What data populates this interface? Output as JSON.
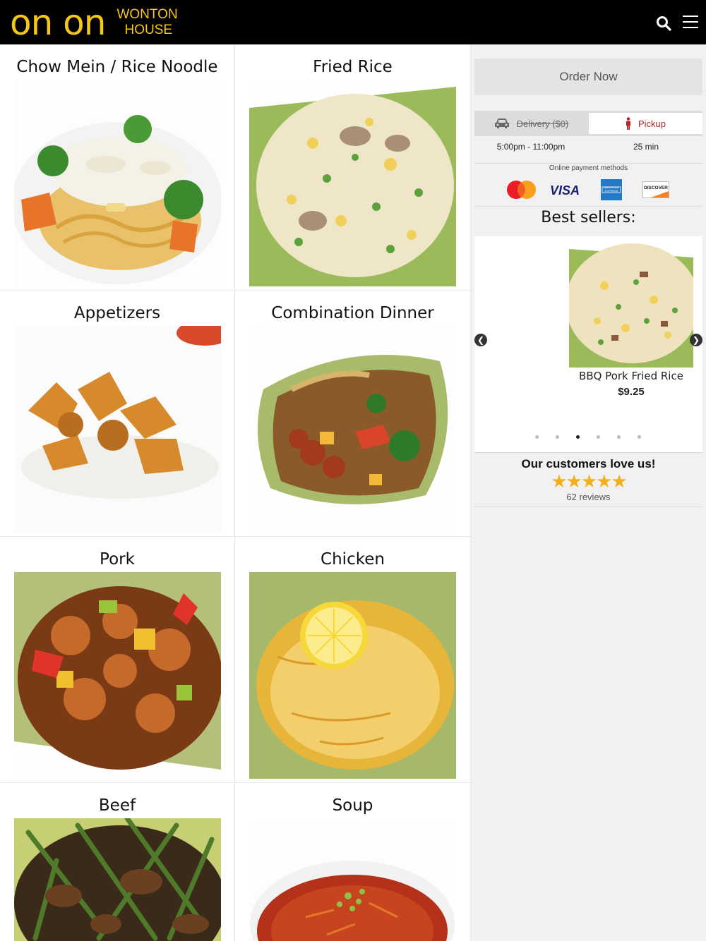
{
  "header": {
    "logo_mark": "on on",
    "logo_line1": "WONTON",
    "logo_line2": "HOUSE",
    "search_icon": "search-icon",
    "menu_icon": "hamburger-menu-icon",
    "brand_color": "#f5c518"
  },
  "categories": [
    {
      "title": "Chow Mein / Rice Noodle",
      "image": "chow-mein-photo"
    },
    {
      "title": "Fried Rice",
      "image": "fried-rice-photo"
    },
    {
      "title": "Appetizers",
      "image": "appetizers-photo"
    },
    {
      "title": "Combination Dinner",
      "image": "combination-dinner-photo"
    },
    {
      "title": "Pork",
      "image": "pork-photo"
    },
    {
      "title": "Chicken",
      "image": "chicken-photo"
    },
    {
      "title": "Beef",
      "image": "beef-photo"
    },
    {
      "title": "Soup",
      "image": "soup-photo"
    }
  ],
  "sidebar": {
    "order_now": "Order Now",
    "delivery_label": "Delivery ($0)",
    "pickup_label": "Pickup",
    "hours": "5:00pm - 11:00pm",
    "eta": "25 min",
    "payment_label": "Online payment methods",
    "payment_methods": [
      "mastercard",
      "VISA",
      "AMERICAN EXPRESS",
      "DISCOVER"
    ],
    "best_sellers_title": "Best sellers:",
    "best_seller": {
      "name": "BBQ Pork Fried Rice",
      "price": "$9.25"
    },
    "carousel_dot_count": 6,
    "carousel_active_dot": 3,
    "reviews_heading": "Our customers love us!",
    "rating": 5,
    "reviews_count": "62 reviews",
    "accent_color": "#b3262a",
    "star_color": "#f2b01e"
  }
}
